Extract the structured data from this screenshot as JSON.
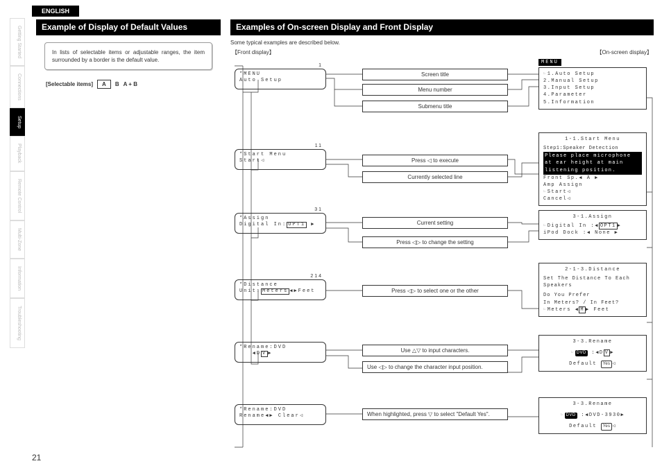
{
  "lang_tab": "ENGLISH",
  "side_tabs": [
    "Getting Started",
    "Connections",
    "Setup",
    "Playback",
    "Remote Control",
    "Multi-Zone",
    "Information",
    "Troubleshooting"
  ],
  "side_active_index": 2,
  "page_number": "21",
  "left": {
    "heading": "Example of Display of Default Values",
    "note": "In lists of selectable items or adjustable ranges, the item surrounded by a border is the default value.",
    "sel_label": "[Selectable items]",
    "sel_a": "A",
    "sel_b": "B",
    "sel_ab": "A + B"
  },
  "right": {
    "heading": "Examples of On-screen Display and Front Display",
    "typical": "Some typical examples are described below.",
    "legend_front": "Front display",
    "legend_osd": "On-screen display",
    "menu_pill": "MENU",
    "lcd": [
      {
        "num": "1",
        "l1": "*MENU",
        "l2": "Auto Setup",
        "hl2": false
      },
      {
        "num": "11",
        "l1": "*Start Menu",
        "l2": "Start◁",
        "hl2": false
      },
      {
        "num": "31",
        "l1": "*Assign",
        "l2": "Digital In:",
        "l2b": "OPT1",
        "l2c": " ▶"
      },
      {
        "num": "214",
        "l1": "*Distance",
        "l2": "Unit:",
        "l2b": "Meters",
        "l2c": "◀▶Feet"
      },
      {
        "num": "",
        "l1": "*Rename:DVD",
        "l2": "   ◀D",
        "l2b": "V",
        "l2c": "▶"
      },
      {
        "num": "",
        "l1": "*Rename:DVD",
        "l2": "Rename◀▶ Clear◁"
      }
    ],
    "desc": [
      "Screen title",
      "Menu number",
      "Submenu title",
      "Press ◁ to execute",
      "Currently selected line",
      "Current setting",
      "Press ◁▷ to change the setting",
      "Press ◁▷ to select one or the other",
      "Use △▽ to input characters.",
      "Use ◁▷ to change the character input position.",
      "When highlighted, press ▽ to select \"Default Yes\"."
    ],
    "osd": {
      "b1": {
        "l1": "☞1.Auto Setup",
        "l2": "  2.Manual Setup",
        "l3": "  3.Input Setup",
        "l4": "  4.Parameter",
        "l5": "  5.Information"
      },
      "b2": {
        "title": "1-1.Start Menu",
        "sub": "Step1:Speaker Detection",
        "inv": "Please place microphone at ear height at main listening position.",
        "l1": "  Front Sp.◀ A ▶",
        "l2": "  Amp Assign",
        "l3": "☞Start◁",
        "l4": "  Cancel◁"
      },
      "b3": {
        "title": "3-1.Assign",
        "l1": "☞Digital In  :",
        "l1b": "OPT1",
        "l2": "  iPod Dock  :◀ None  ▶"
      },
      "b4": {
        "title": "2-1-3.Distance",
        "l1": "Set The Distance To Each Speakers",
        "l2": "Do You Prefer",
        "l3": "  In Meters? / In Feet?",
        "l4": "☞Meters ◀",
        "l4b": "M",
        "l4c": "▶ Feet"
      },
      "b5": {
        "title": "3-3.Rename",
        "pill": "DVD",
        "mid": ":◀D",
        "midb": "V",
        "midc": "▶",
        "def": "Default ",
        "defb": "Yes"
      },
      "b6": {
        "title": "3-3.Rename",
        "pill": "DVD",
        "mid": ":◀DVD-3930▶",
        "def": "Default ",
        "defb": "Yes"
      }
    }
  }
}
